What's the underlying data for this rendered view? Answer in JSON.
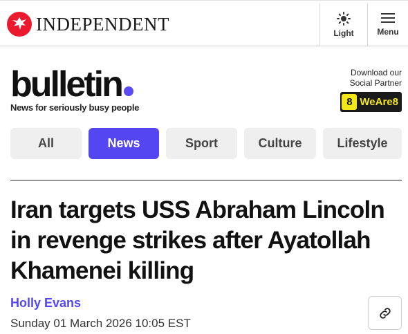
{
  "header": {
    "brand_name": "INDEPENDENT",
    "light_label": "Light",
    "menu_label": "Menu"
  },
  "bulletin": {
    "word": "bulletin",
    "tagline": "News for seriously busy people",
    "partner_line1": "Download our",
    "partner_line2": "Social Partner",
    "partner_badge_number": "8",
    "partner_badge_name": "WeAre8"
  },
  "tabs": [
    {
      "label": "All",
      "active": false
    },
    {
      "label": "News",
      "active": true
    },
    {
      "label": "Sport",
      "active": false
    },
    {
      "label": "Culture",
      "active": false
    },
    {
      "label": "Lifestyle",
      "active": false
    }
  ],
  "article": {
    "headline": "Iran targets USS Abraham Lincoln in revenge strikes after Ayatollah Khamenei killing",
    "author": "Holly Evans",
    "date": "Sunday 01 March 2026 10:05 EST"
  },
  "icons": {
    "brand_logo": "eagle-logo",
    "light": "sun-icon",
    "menu": "hamburger-icon",
    "share": "link-icon"
  },
  "colors": {
    "brand_red": "#ec1a2e",
    "accent_purple": "#5446f0",
    "weare8_yellow": "#f3e71c"
  }
}
